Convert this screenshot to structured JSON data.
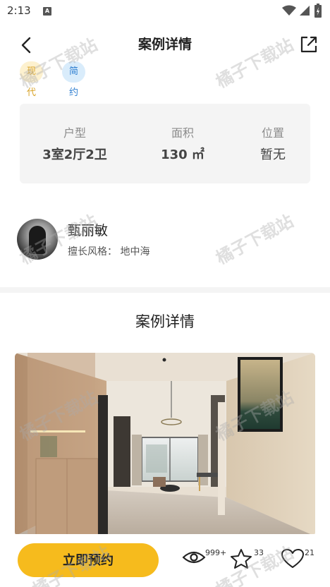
{
  "status_bar": {
    "time": "2:13",
    "notification_icon": "A"
  },
  "header": {
    "title": "案例详情"
  },
  "tags": [
    "现代",
    "简约"
  ],
  "info": {
    "layout_label": "户型",
    "layout_value": "3室2厅2卫",
    "area_label": "面积",
    "area_value": "130 ㎡",
    "location_label": "位置",
    "location_value": "暂无"
  },
  "designer": {
    "name": "甄丽敏",
    "style_label": "擅长风格：",
    "style_value": "地中海"
  },
  "section": {
    "title": "案例详情"
  },
  "bottom_bar": {
    "book_label": "立即预约",
    "views": "999+",
    "favorites": "33",
    "likes": "21"
  },
  "watermark": "橘子下载站",
  "colors": {
    "accent": "#f6bb1d",
    "tag_modern_bg": "#fdf1cf",
    "tag_modern_text": "#d9a42a",
    "tag_simple_bg": "#d9ecfb",
    "tag_simple_text": "#2f7fd0",
    "card_bg": "#f4f4f4"
  },
  "icons": [
    "wifi-icon",
    "signal-icon",
    "battery-icon",
    "back-arrow-icon",
    "share-icon",
    "eye-icon",
    "star-icon",
    "heart-icon"
  ]
}
